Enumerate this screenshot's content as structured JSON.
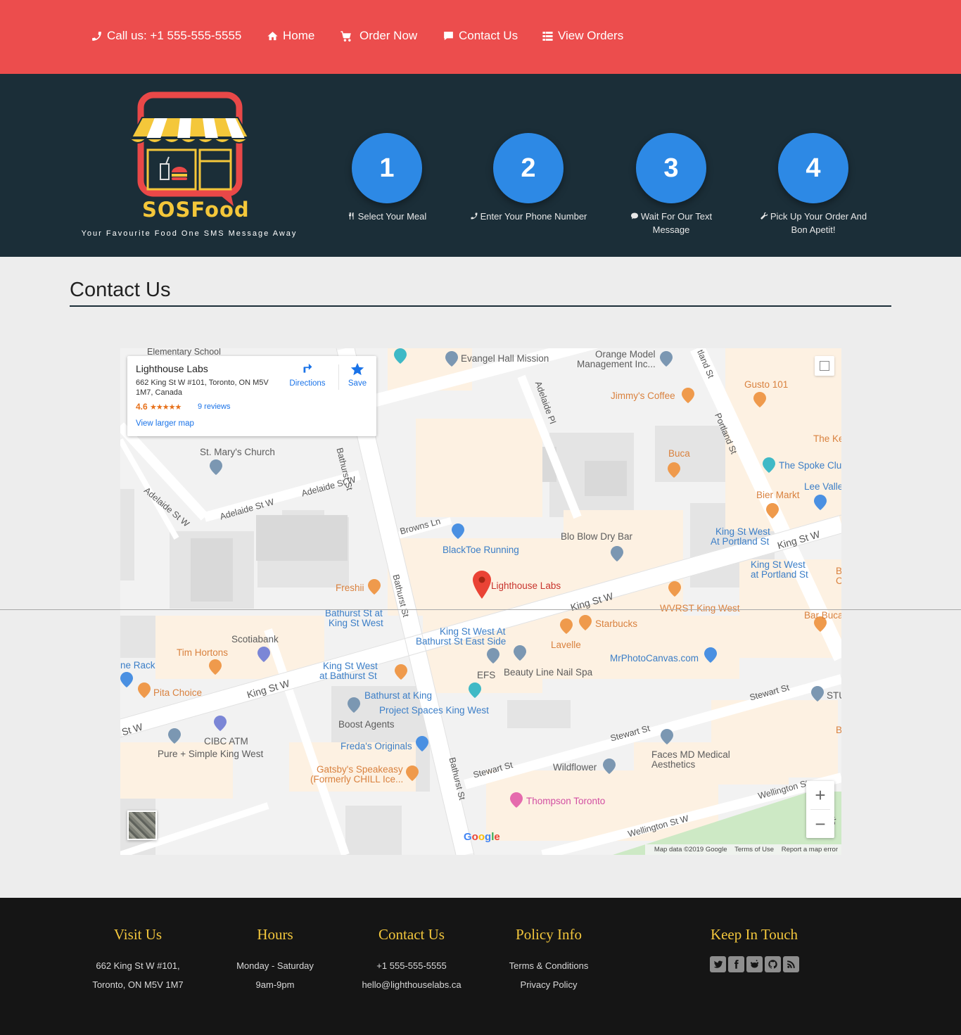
{
  "nav": {
    "call": "Call us: +1 555-555-5555",
    "home": "Home",
    "order": "Order Now",
    "contact": "Contact Us",
    "orders": "View Orders"
  },
  "brand": {
    "name": "SOSFood",
    "tagline": "Your Favourite Food One SMS Message Away"
  },
  "steps": [
    {
      "number": "1",
      "label": "Select Your Meal",
      "icon": "utensils-icon"
    },
    {
      "number": "2",
      "label": "Enter Your Phone Number",
      "icon": "phone-icon"
    },
    {
      "number": "3",
      "label": "Wait For Our Text Message",
      "icon": "chat-icon"
    },
    {
      "number": "4",
      "label": "Pick Up Your Order And Bon Apetit!",
      "icon": "wrench-icon"
    }
  ],
  "contact": {
    "title": "Contact Us"
  },
  "map": {
    "place": {
      "name": "Lighthouse Labs",
      "address": "662 King St W #101, Toronto, ON M5V 1M7, Canada",
      "rating": "4.6",
      "stars": "★★★★★",
      "reviews": "9 reviews",
      "larger_map": "View larger map",
      "directions": "Directions",
      "save": "Save"
    },
    "labels": {
      "elementary": "Elementary School",
      "evangel": "Evangel Hall Mission",
      "orange_model_1": "Orange Model",
      "orange_model_2": "Management Inc...",
      "jimmys": "Jimmy's Coffee",
      "gusto": "Gusto 101",
      "the_ke": "The Ke",
      "spoke": "The Spoke Clu",
      "lee_valley": "Lee Valle",
      "bier": "Bier Markt",
      "buca": "Buca",
      "st_marys": "St. Mary's Church",
      "blacktoe": "BlackToe Running",
      "blo": "Blo Blow Dry Bar",
      "ksw_portland_1a": "King St West",
      "ksw_portland_1b": "At Portland St",
      "ksw_portland_2a": "King St West",
      "ksw_portland_2b": "at Portland St",
      "freshii": "Freshii",
      "lighthouse": "Lighthouse Labs",
      "wvrst": "WVRST King West",
      "bar_buca": "Bar Buca",
      "bathurst_king_1": "Bathurst St at",
      "bathurst_king_2": "King St West",
      "ksw_bathurst_east_1": "King St West At",
      "ksw_bathurst_east_2": "Bathurst St East Side",
      "starbucks": "Starbucks",
      "lavelle": "Lavelle",
      "scotiabank": "Scotiabank",
      "tim_hortons": "Tim Hortons",
      "ne_rack": "ne Rack",
      "ksw_at_bathurst_1": "King St West",
      "ksw_at_bathurst_2": "at Bathurst St",
      "efs": "EFS",
      "beauty_line": "Beauty Line Nail Spa",
      "mrphoto": "MrPhotoCanvas.com",
      "pita": "Pita Choice",
      "stu": "STU",
      "bathurst_at_king": "Bathurst at King",
      "project_spaces": "Project Spaces King West",
      "boost": "Boost Agents",
      "cibc": "CIBC ATM",
      "pure_simple": "Pure + Simple King West",
      "fredas": "Freda's Originals",
      "faces_1": "Faces MD Medical",
      "faces_2": "Aesthetics",
      "wildflower": "Wildflower",
      "gatsby_1": "Gatsby's Speakeasy",
      "gatsby_2": "(Formerly CHILL Ice...",
      "thompson": "Thompson Toronto",
      "b_edge1": "B",
      "c_edge": "C",
      "b_edge2": "B",
      "portland_edge": "Portla"
    },
    "streets": {
      "bathurst_top": "Bathurst St",
      "bathurst_mid": "Bathurst St",
      "bathurst_bottom": "Bathurst St",
      "adelaide_pl": "Adelaide Pl",
      "portland": "Portland St",
      "portland_top": "tland St",
      "adelaide_w1": "Adelaide St W",
      "adelaide_w2": "Adelaide St W",
      "adelaide_w3": "Adelaide St W",
      "browns": "Browns Ln",
      "king_w1": "King St W",
      "king_w2": "King St W",
      "king_w3": "King St W",
      "king_w_edge": "St W",
      "stewart1": "Stewart St",
      "stewart2": "Stewart St",
      "stewart3": "Stewart St",
      "wellington1": "Wellington St W",
      "wellington2": "Wellington St"
    },
    "google": "Google",
    "attribution": {
      "data": "Map data ©2019 Google",
      "terms": "Terms of Use",
      "report": "Report a map error"
    },
    "zoom_in": "+",
    "zoom_out": "−"
  },
  "footer": {
    "visit": {
      "title": "Visit Us",
      "line1": "662 King St W #101,",
      "line2": "Toronto, ON M5V 1M7"
    },
    "hours": {
      "title": "Hours",
      "line1": "Monday - Saturday",
      "line2": "9am-9pm"
    },
    "contact": {
      "title": "Contact Us",
      "line1": "+1 555-555-5555",
      "line2": "hello@lighthouselabs.ca"
    },
    "policy": {
      "title": "Policy Info",
      "line1": "Terms & Conditions",
      "line2": "Privacy Policy"
    },
    "social": {
      "title": "Keep In Touch",
      "icons": [
        "twitter-icon",
        "facebook-icon",
        "reddit-icon",
        "github-icon",
        "rss-icon"
      ]
    }
  },
  "colors": {
    "nav_bg": "#ec4d4d",
    "hero_bg": "#1b2e38",
    "step_circle": "#2d89e5",
    "footer_bg": "#151515",
    "footer_heading": "#f2c63c",
    "page_bg": "#ededed"
  }
}
